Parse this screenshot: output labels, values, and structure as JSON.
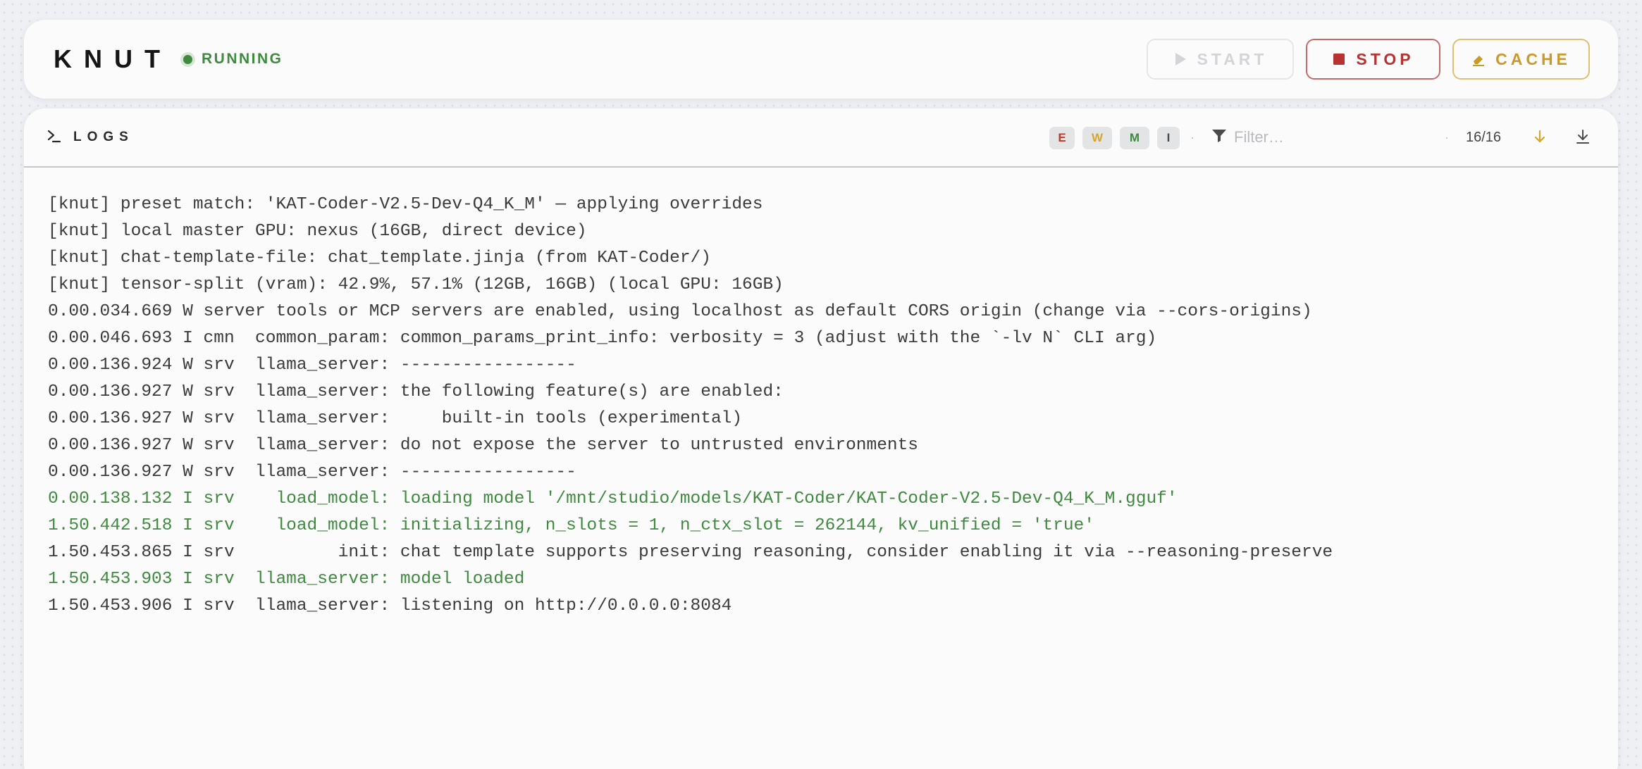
{
  "app": {
    "title": "KNUT",
    "status": "RUNNING"
  },
  "toolbar": {
    "start_label": "START",
    "stop_label": "STOP",
    "cache_label": "CACHE"
  },
  "logs": {
    "title": "LOGS",
    "levels": [
      "E",
      "W",
      "M",
      "I"
    ],
    "filter_placeholder": "Filter…",
    "separator": "·",
    "count": "16/16",
    "lines": [
      {
        "text": "[knut] preset match: 'KAT-Coder-V2.5-Dev-Q4_K_M' — applying overrides",
        "tone": "default"
      },
      {
        "text": "[knut] local master GPU: nexus (16GB, direct device)",
        "tone": "default"
      },
      {
        "text": "[knut] chat-template-file: chat_template.jinja (from KAT-Coder/)",
        "tone": "default"
      },
      {
        "text": "[knut] tensor-split (vram): 42.9%, 57.1% (12GB, 16GB) (local GPU: 16GB)",
        "tone": "default"
      },
      {
        "text": "0.00.034.669 W server tools or MCP servers are enabled, using localhost as default CORS origin (change via --cors-origins)",
        "tone": "default"
      },
      {
        "text": "0.00.046.693 I cmn  common_param: common_params_print_info: verbosity = 3 (adjust with the `-lv N` CLI arg)",
        "tone": "default"
      },
      {
        "text": "0.00.136.924 W srv  llama_server: -----------------",
        "tone": "default"
      },
      {
        "text": "0.00.136.927 W srv  llama_server: the following feature(s) are enabled:",
        "tone": "default"
      },
      {
        "text": "0.00.136.927 W srv  llama_server:     built-in tools (experimental)",
        "tone": "default"
      },
      {
        "text": "0.00.136.927 W srv  llama_server: do not expose the server to untrusted environments",
        "tone": "default"
      },
      {
        "text": "0.00.136.927 W srv  llama_server: -----------------",
        "tone": "default"
      },
      {
        "text": "0.00.138.132 I srv    load_model: loading model '/mnt/studio/models/KAT-Coder/KAT-Coder-V2.5-Dev-Q4_K_M.gguf'",
        "tone": "ok"
      },
      {
        "text": "1.50.442.518 I srv    load_model: initializing, n_slots = 1, n_ctx_slot = 262144, kv_unified = 'true'",
        "tone": "ok"
      },
      {
        "text": "1.50.453.865 I srv          init: chat template supports preserving reasoning, consider enabling it via --reasoning-preserve",
        "tone": "default"
      },
      {
        "text": "1.50.453.903 I srv  llama_server: model loaded",
        "tone": "ok"
      },
      {
        "text": "1.50.453.906 I srv  llama_server: listening on http://0.0.0.0:8084",
        "tone": "default"
      }
    ]
  },
  "icons": {
    "start": "play-icon",
    "stop": "stop-square-icon",
    "cache": "eraser-icon",
    "logs": "terminal-prompt-icon",
    "filter": "funnel-icon",
    "follow": "arrow-down-icon",
    "download": "download-icon"
  },
  "colors": {
    "ok": "#3f8a3f",
    "error": "#b83232",
    "warn": "#c9992b",
    "text": "#3b3b3b",
    "disabled": "#d2d4d7"
  }
}
